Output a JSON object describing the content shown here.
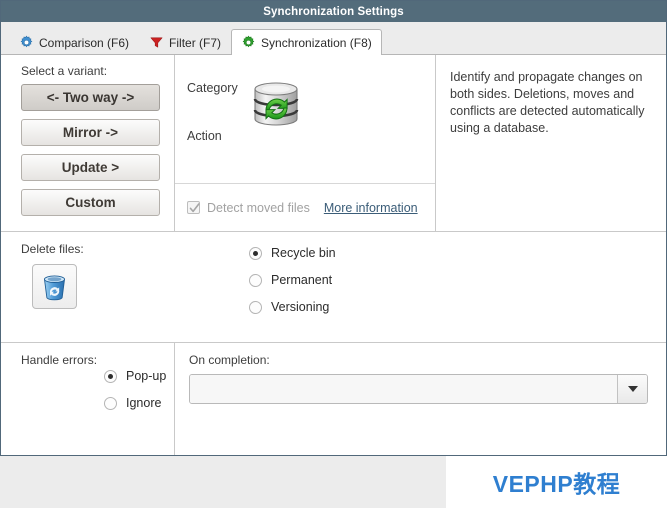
{
  "window": {
    "title": "Synchronization Settings"
  },
  "tabs": [
    {
      "label": "Comparison (F6)",
      "icon": "blue-gear-icon",
      "active": false
    },
    {
      "label": "Filter (F7)",
      "icon": "red-funnel-icon",
      "active": false
    },
    {
      "label": "Synchronization (F8)",
      "icon": "green-gear-icon",
      "active": true
    }
  ],
  "variant": {
    "label": "Select a variant:",
    "buttons": [
      {
        "label": "<- Two way ->",
        "selected": true
      },
      {
        "label": "Mirror ->",
        "selected": false
      },
      {
        "label": "Update >",
        "selected": false
      },
      {
        "label": "Custom",
        "selected": false
      }
    ]
  },
  "category": {
    "category_label": "Category",
    "action_label": "Action",
    "icon": "database-sync-icon",
    "detect_moved_files": {
      "label": "Detect moved files",
      "checked": true,
      "enabled": false
    },
    "more_information_link": "More information"
  },
  "description": {
    "text": "Identify and propagate changes on both sides. Deletions, moves and conflicts are detected automatically using a database."
  },
  "delete_files": {
    "label": "Delete files:",
    "icon": "recycle-bin-icon",
    "options": [
      {
        "label": "Recycle bin",
        "selected": true
      },
      {
        "label": "Permanent",
        "selected": false
      },
      {
        "label": "Versioning",
        "selected": false
      }
    ]
  },
  "handle_errors": {
    "label": "Handle errors:",
    "options": [
      {
        "label": "Pop-up",
        "selected": true
      },
      {
        "label": "Ignore",
        "selected": false
      }
    ]
  },
  "on_completion": {
    "label": "On completion:",
    "value": "",
    "placeholder": ""
  },
  "watermark": {
    "text": "VEPHP教程"
  },
  "colors": {
    "titlebar": "#536c7b",
    "accent_link": "#3b5d78",
    "watermark": "#2f7fd0",
    "green_icon": "#2ea02e",
    "blue_icon": "#2f7fd0",
    "red_icon": "#cc2222"
  }
}
